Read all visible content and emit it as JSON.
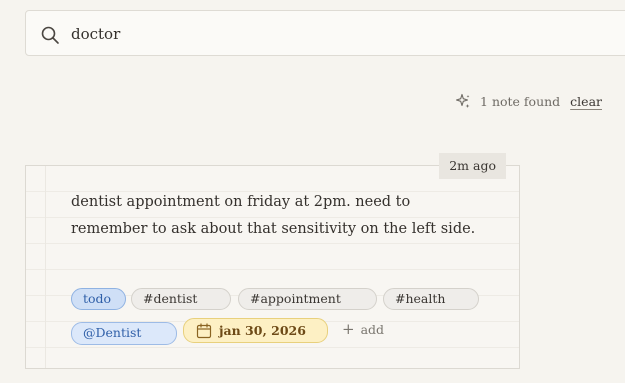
{
  "search": {
    "value": "doctor",
    "icon": "search-icon"
  },
  "results": {
    "icon": "sparkle-icon",
    "count_text": "1 note found",
    "clear_label": "clear"
  },
  "note": {
    "timestamp": "2m ago",
    "body": "dentist appointment on friday at 2pm. need to remember to ask about that sensitivity on the left side.",
    "tags": {
      "todo": "todo",
      "dentist": "#dentist",
      "appointment": "#appointment",
      "health": "#health"
    },
    "mention": "@Dentist",
    "date": {
      "icon": "calendar-icon",
      "label": "jan 30, 2026"
    },
    "add_label": "add"
  },
  "colors": {
    "background": "#f6f4ef",
    "todo_accent": "#2f5fa8",
    "date_accent": "#fdf0c4"
  }
}
